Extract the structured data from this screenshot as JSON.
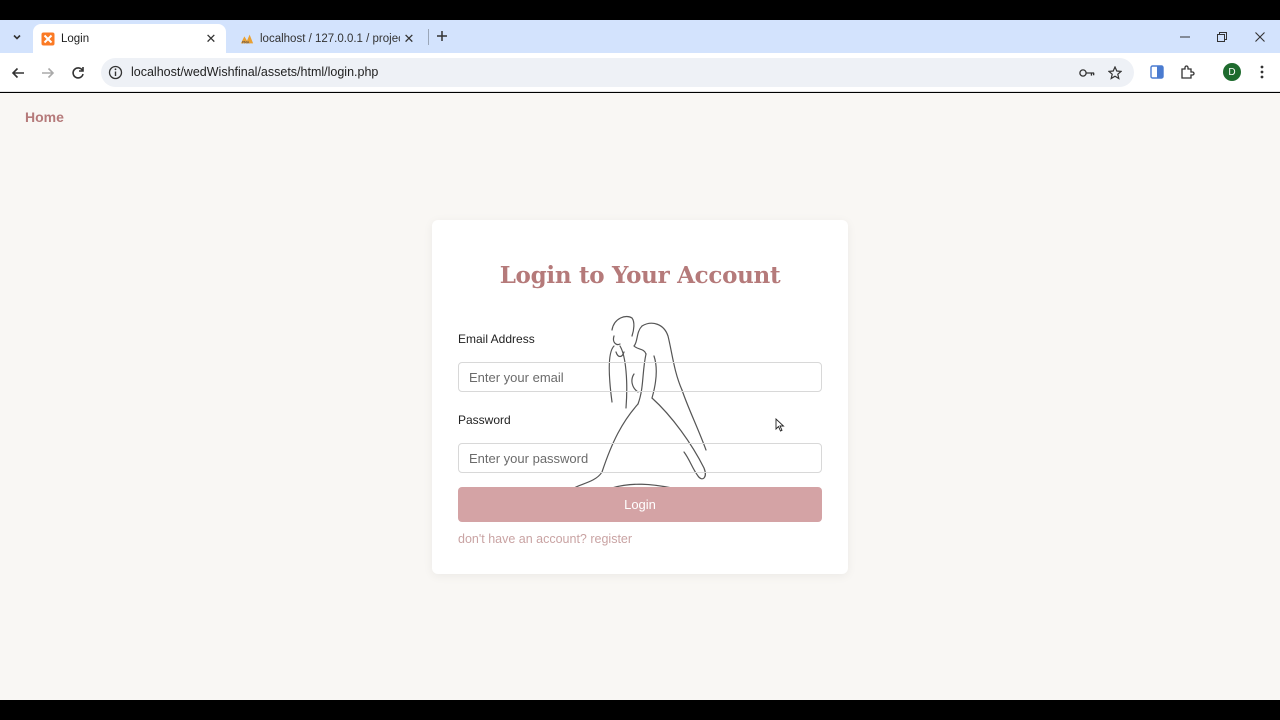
{
  "browser": {
    "tabs": [
      {
        "title": "Login",
        "active": true,
        "favicon": "xampp-icon"
      },
      {
        "title": "localhost / 127.0.0.1 / project / ...",
        "active": false,
        "favicon": "phpmyadmin-icon"
      }
    ],
    "url": "localhost/wedWishfinal/assets/html/login.php",
    "profile_initial": "D"
  },
  "page": {
    "nav": {
      "home_label": "Home"
    },
    "login_card": {
      "title": "Login to Your Account",
      "email_label": "Email Address",
      "email_placeholder": "Enter your email",
      "password_label": "Password",
      "password_placeholder": "Enter your password",
      "submit_label": "Login",
      "register_text": "don't have an account? register"
    },
    "colors": {
      "accent": "#b57a7a",
      "button": "#d4a3a5",
      "link": "#c9a3a3",
      "background": "#f9f7f4"
    }
  }
}
